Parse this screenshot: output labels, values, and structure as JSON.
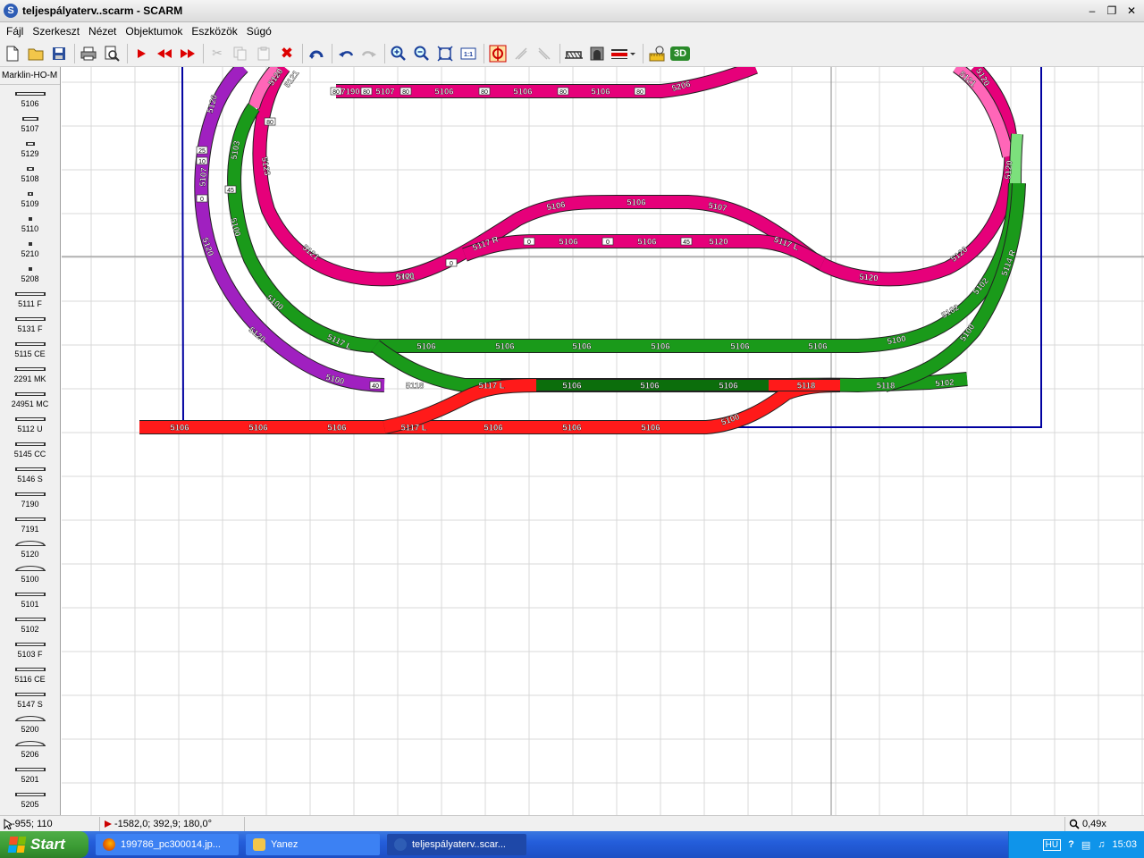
{
  "window": {
    "title": "teljespályaterv..scarm - SCARM",
    "app_icon": "S",
    "controls": [
      "minimize",
      "maximize",
      "close"
    ]
  },
  "menu": [
    "Fájl",
    "Szerkeszt",
    "Nézet",
    "Objektumok",
    "Eszközök",
    "Súgó"
  ],
  "toolbar": {
    "tool_3d_label": "3D",
    "tools": [
      {
        "icon": "new-file-icon",
        "enabled": true
      },
      {
        "icon": "open-folder-icon",
        "enabled": true
      },
      {
        "icon": "save-icon",
        "enabled": true
      },
      {
        "icon": "print-icon",
        "enabled": true
      },
      {
        "icon": "print-preview-icon",
        "enabled": true
      },
      {
        "icon": "play-icon",
        "enabled": true
      },
      {
        "icon": "rewind-icon",
        "enabled": true
      },
      {
        "icon": "fast-forward-icon",
        "enabled": true
      },
      {
        "icon": "cut-icon",
        "enabled": false
      },
      {
        "icon": "copy-icon",
        "enabled": false
      },
      {
        "icon": "paste-icon",
        "enabled": false
      },
      {
        "icon": "delete-icon",
        "enabled": true
      },
      {
        "icon": "rotate-icon",
        "enabled": true
      },
      {
        "icon": "undo-icon",
        "enabled": true
      },
      {
        "icon": "redo-icon",
        "enabled": false
      },
      {
        "icon": "zoom-in-icon",
        "enabled": true
      },
      {
        "icon": "zoom-out-icon",
        "enabled": true
      },
      {
        "icon": "zoom-fit-icon",
        "enabled": true
      },
      {
        "icon": "zoom-1-1-icon",
        "enabled": true
      },
      {
        "icon": "track-mode-icon",
        "enabled": true
      },
      {
        "icon": "flex-track-icon",
        "enabled": false
      },
      {
        "icon": "flex-track2-icon",
        "enabled": false
      },
      {
        "icon": "bridge-icon",
        "enabled": true
      },
      {
        "icon": "tunnel-icon",
        "enabled": true
      },
      {
        "icon": "layer-color-icon",
        "enabled": true
      },
      {
        "icon": "measure-icon",
        "enabled": true
      },
      {
        "icon": "view-3d-icon",
        "enabled": true
      }
    ]
  },
  "library": {
    "selected": "Marklin-HO-M",
    "parts": [
      "5106",
      "5107",
      "5129",
      "5108",
      "5109",
      "5110",
      "5210",
      "5208",
      "5111 F",
      "5131 F",
      "5115 CE",
      "2291 MK",
      "24951 MC",
      "5112 U",
      "5145 CC",
      "5146 S",
      "7190",
      "7191",
      "5120",
      "5100",
      "5101",
      "5102",
      "5103 F",
      "5116 CE",
      "5147 S",
      "5200",
      "5206",
      "5201",
      "5205"
    ]
  },
  "layout": {
    "colors": {
      "pink": "#e6007a",
      "pink_light": "#ff66b8",
      "green": "#1a9a1a",
      "green_dark": "#0c6e0c",
      "green_light": "#7ce07c",
      "red": "#ff1a1a",
      "purple": "#a020c0",
      "board_outline": "#0000a0",
      "grid": "#d9d9d9",
      "label_text": "#ffffff"
    },
    "pink_labels": [
      "7190",
      "5107",
      "5106",
      "5106",
      "5106",
      "5206",
      "5121",
      "5120",
      "5120",
      "5123",
      "5120",
      "5121",
      "5100",
      "5106",
      "5106",
      "5107",
      "5120",
      "5120",
      "5121",
      "5120",
      "5121",
      "5117 R",
      "5117 L",
      "5106",
      "5106"
    ],
    "green_labels": [
      "5103",
      "5100",
      "5100",
      "5117 L",
      "5106",
      "5106",
      "5106",
      "5106",
      "5106",
      "5106",
      "5100",
      "5102",
      "5102",
      "5100",
      "5114 R",
      "5118",
      "5106",
      "5106",
      "5106",
      "5118",
      "5102"
    ],
    "red_labels": [
      "5106",
      "5106",
      "5106",
      "5117 L",
      "5106",
      "5106",
      "5106",
      "5117 L",
      "5118",
      "5100"
    ],
    "purple_labels": [
      "5120",
      "5107",
      "5120",
      "5120",
      "5100"
    ],
    "elevation_marks": [
      "80",
      "80",
      "80",
      "80",
      "80",
      "80",
      "80",
      "0",
      "0",
      "0",
      "45",
      "45",
      "40",
      "25",
      "10",
      "0"
    ]
  },
  "status": {
    "cursor": "-955; 110",
    "position": "-1582,0; 392,9; 180,0°",
    "zoom": "0,49x"
  },
  "taskbar": {
    "start_label": "Start",
    "tasks": [
      "199786_pc300014.jp...",
      "Yanez",
      "teljespályaterv..scar..."
    ],
    "tray_lang": "HU",
    "clock": "15:03"
  }
}
